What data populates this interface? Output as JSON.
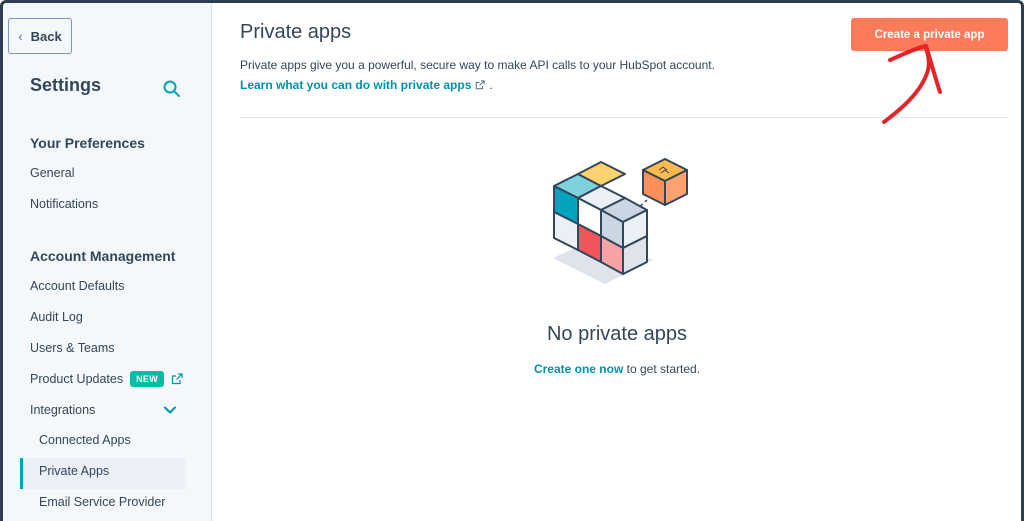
{
  "sidebar": {
    "back_label": "Back",
    "title": "Settings",
    "sections": [
      {
        "heading": "Your Preferences",
        "items": [
          "General",
          "Notifications"
        ]
      },
      {
        "heading": "Account Management",
        "items": [
          "Account Defaults",
          "Audit Log",
          "Users & Teams",
          "Product Updates",
          "Integrations",
          "Connected Apps",
          "Private Apps",
          "Email Service Provider"
        ]
      }
    ],
    "new_badge": "NEW",
    "active_item": "Private Apps"
  },
  "main": {
    "title": "Private apps",
    "description": "Private apps give you a powerful, secure way to make API calls to your HubSpot account.",
    "learn_link": "Learn what you can do with private apps",
    "learn_suffix": ".",
    "create_button": "Create a private app",
    "empty_title": "No private apps",
    "empty_link": "Create one now",
    "empty_suffix": " to get started."
  },
  "colors": {
    "accent": "#ff7a59",
    "link": "#0091ae",
    "badge": "#00bda5",
    "annotation": "#e5242a"
  },
  "icons": [
    "chevron-left-icon",
    "search-icon",
    "external-link-icon",
    "chevron-down-icon",
    "cubes-illustration",
    "arrow-annotation"
  ]
}
